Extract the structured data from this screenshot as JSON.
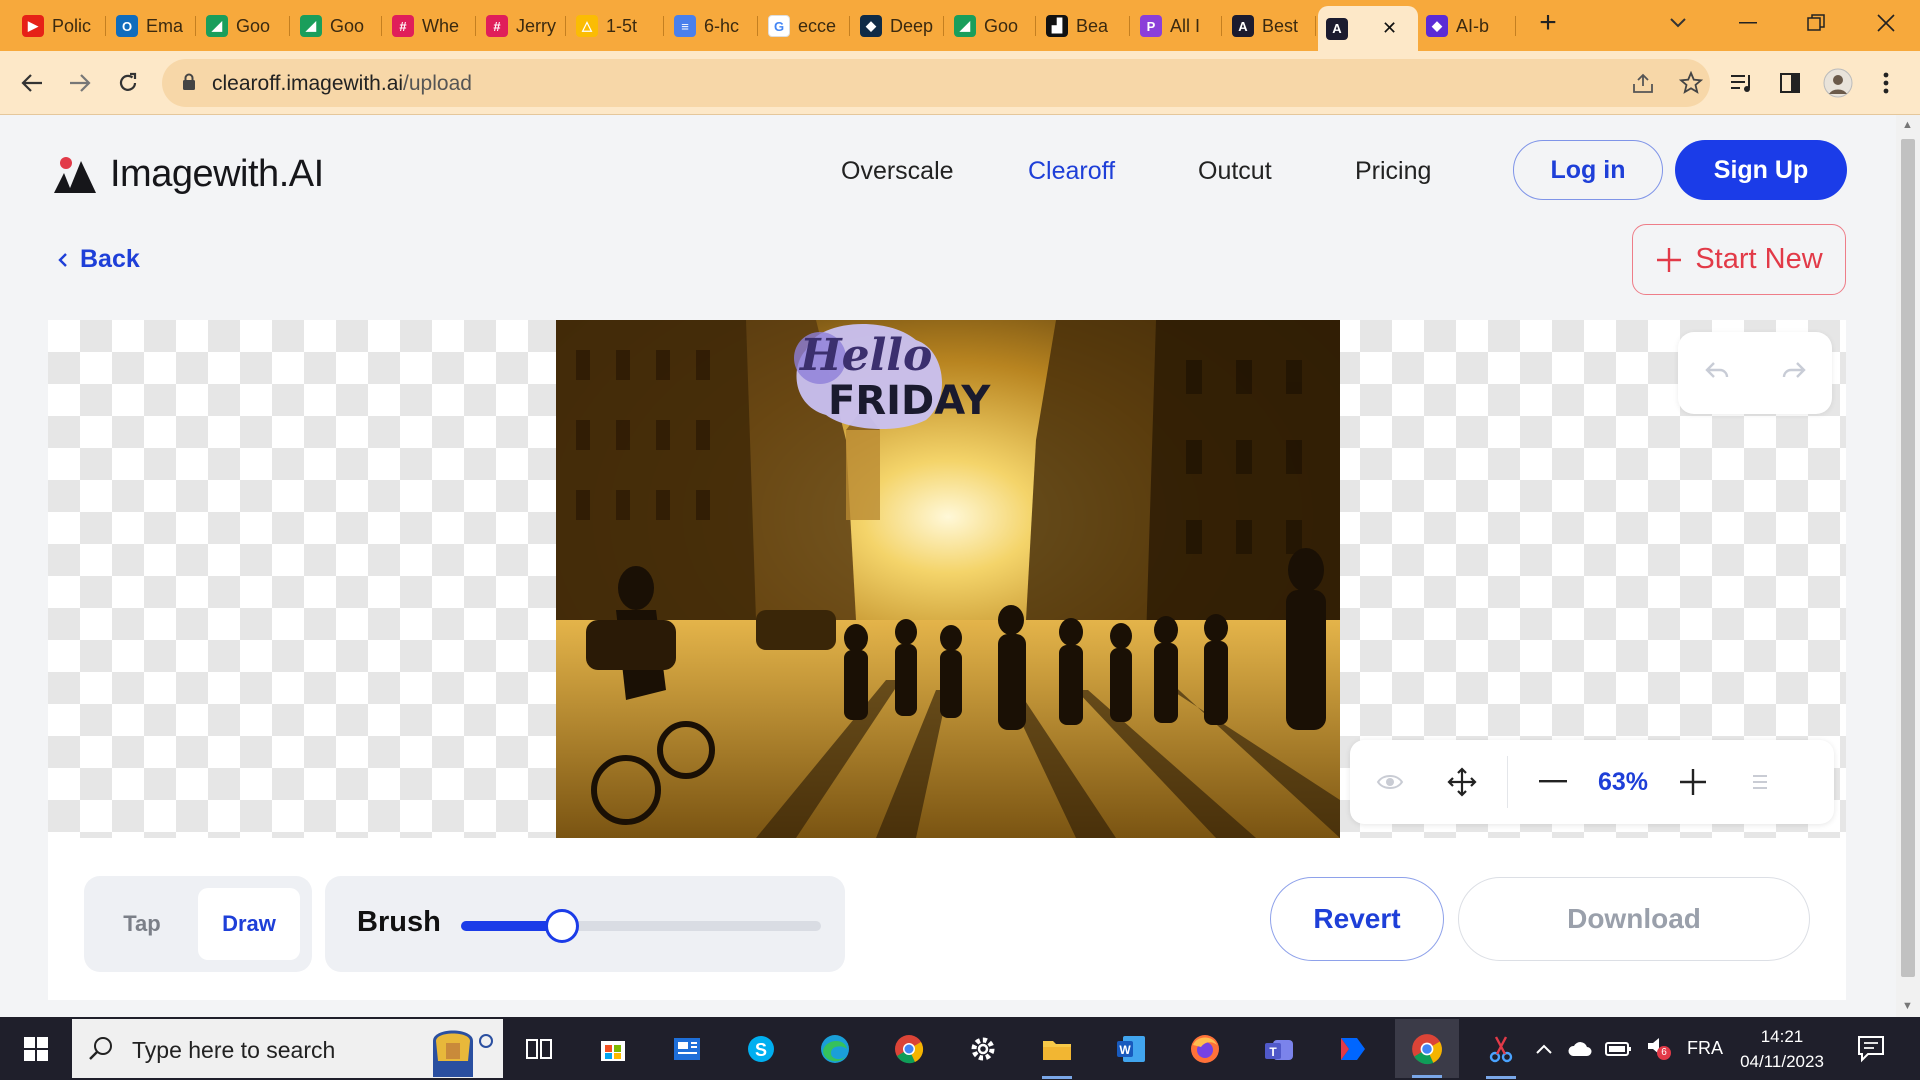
{
  "browser": {
    "tabs": [
      {
        "label": "Polic",
        "color": "#e62117",
        "glyph": "▶"
      },
      {
        "label": "Ema",
        "color": "#0f6cbd",
        "glyph": "O"
      },
      {
        "label": "Goo",
        "color": "#1a9e5b",
        "glyph": "◢"
      },
      {
        "label": "Goo",
        "color": "#1a9e5b",
        "glyph": "◢"
      },
      {
        "label": "Whe",
        "color": "#e01e5a",
        "glyph": "#"
      },
      {
        "label": "Jerry",
        "color": "#e01e5a",
        "glyph": "#"
      },
      {
        "label": "1-5t",
        "color": "#fbbc04",
        "glyph": "△"
      },
      {
        "label": "6-hc",
        "color": "#4a80ec",
        "glyph": "≡"
      },
      {
        "label": "ecce",
        "color": "#ffffff",
        "glyph": "G"
      },
      {
        "label": "Deep",
        "color": "#0f2b46",
        "glyph": "◆"
      },
      {
        "label": "Goo",
        "color": "#1a9e5b",
        "glyph": "◢"
      },
      {
        "label": "Bea",
        "color": "#111111",
        "glyph": "▟"
      },
      {
        "label": "All I",
        "color": "#8b3fd9",
        "glyph": "P"
      },
      {
        "label": "Best",
        "color": "#1b1b2f",
        "glyph": "A"
      },
      {
        "label": "",
        "color": "#1b1b2f",
        "glyph": "A"
      },
      {
        "label": "AI-b",
        "color": "#5b2bd6",
        "glyph": "◆"
      }
    ],
    "close_glyph": "✕",
    "new_tab_glyph": "+",
    "url_host": "clearoff.imagewith.ai",
    "url_path": "/upload"
  },
  "header": {
    "brand": "Imagewith.AI",
    "nav": [
      "Overscale",
      "Clearoff",
      "Outcut",
      "Pricing"
    ],
    "login": "Log in",
    "signup": "Sign Up"
  },
  "toolbar_row": {
    "back": "Back",
    "start_new": "Start New"
  },
  "image": {
    "overlay_line1": "Hello",
    "overlay_line2": "FRIDAY"
  },
  "zoom": {
    "value": "63%"
  },
  "editor": {
    "mode_tap": "Tap",
    "mode_draw": "Draw",
    "active_mode": "Draw",
    "brush_label": "Brush",
    "brush_level": 0.28,
    "revert": "Revert",
    "download": "Download"
  },
  "taskbar": {
    "search_placeholder": "Type here to search",
    "language": "FRA",
    "time": "14:21",
    "date": "04/11/2023",
    "notification_badge": "6"
  },
  "colors": {
    "accent": "#1b3ce8",
    "danger": "#e23a48",
    "tabstrip": "#f7a93c"
  }
}
